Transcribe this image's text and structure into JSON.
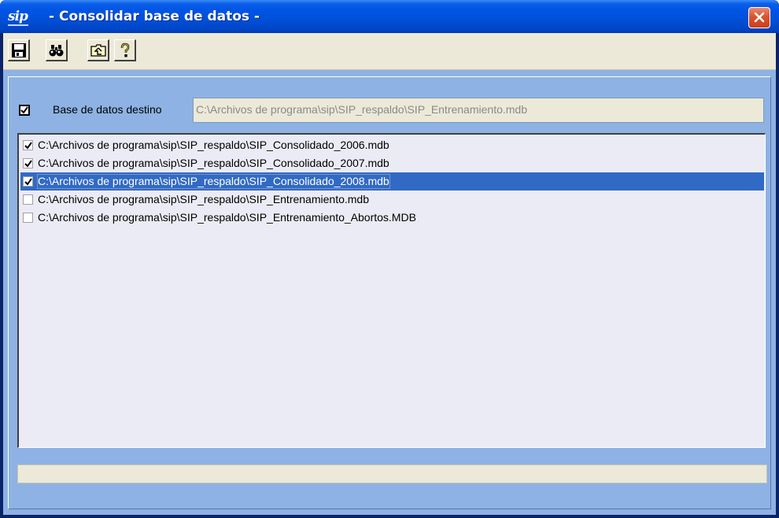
{
  "window": {
    "title": "- Consolidar base de datos -",
    "app_icon_text": "sip"
  },
  "toolbar": {
    "buttons": [
      {
        "icon": "save-icon"
      },
      {
        "icon": "binoculars-icon"
      },
      {
        "icon": "folder-up-icon"
      },
      {
        "icon": "help-icon"
      }
    ]
  },
  "destination": {
    "checked": true,
    "label": "Base de datos destino",
    "path": "C:\\Archivos de programa\\sip\\SIP_respaldo\\SIP_Entrenamiento.mdb"
  },
  "files": [
    {
      "path": "C:\\Archivos de programa\\sip\\SIP_respaldo\\SIP_Consolidado_2006.mdb",
      "checked": true,
      "selected": false
    },
    {
      "path": "C:\\Archivos de programa\\sip\\SIP_respaldo\\SIP_Consolidado_2007.mdb",
      "checked": true,
      "selected": false
    },
    {
      "path": "C:\\Archivos de programa\\sip\\SIP_respaldo\\SIP_Consolidado_2008.mdb",
      "checked": true,
      "selected": true
    },
    {
      "path": "C:\\Archivos de programa\\sip\\SIP_respaldo\\SIP_Entrenamiento.mdb",
      "checked": false,
      "selected": false
    },
    {
      "path": "C:\\Archivos de programa\\sip\\SIP_respaldo\\SIP_Entrenamiento_Abortos.MDB",
      "checked": false,
      "selected": false
    }
  ],
  "colors": {
    "titlebar": "#0055e5",
    "client_background": "#8db2e3",
    "list_background": "#ebebf5",
    "selection": "#316ac5",
    "close_button": "#d9542f"
  }
}
